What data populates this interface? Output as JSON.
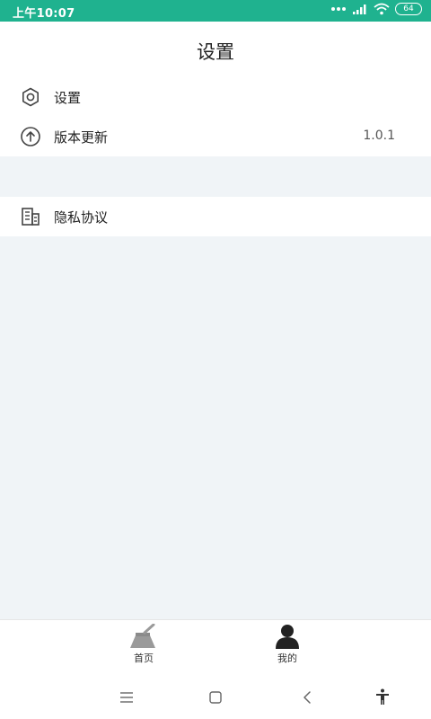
{
  "status_bar": {
    "time": "上午10:07",
    "battery": "64"
  },
  "header": {
    "title": "设置"
  },
  "settings": {
    "items": [
      {
        "label": "设置",
        "icon": "gear-icon"
      },
      {
        "label": "版本更新",
        "value": "1.0.1",
        "icon": "upload-circle-icon"
      }
    ]
  },
  "privacy": {
    "label": "隐私协议",
    "icon": "building-icon"
  },
  "tabbar": {
    "tabs": [
      {
        "label": "首页",
        "icon": "broom-icon"
      },
      {
        "label": "我的",
        "icon": "person-icon"
      }
    ]
  },
  "colors": {
    "status_bar": "#1fb28f",
    "background": "#f0f4f7"
  }
}
